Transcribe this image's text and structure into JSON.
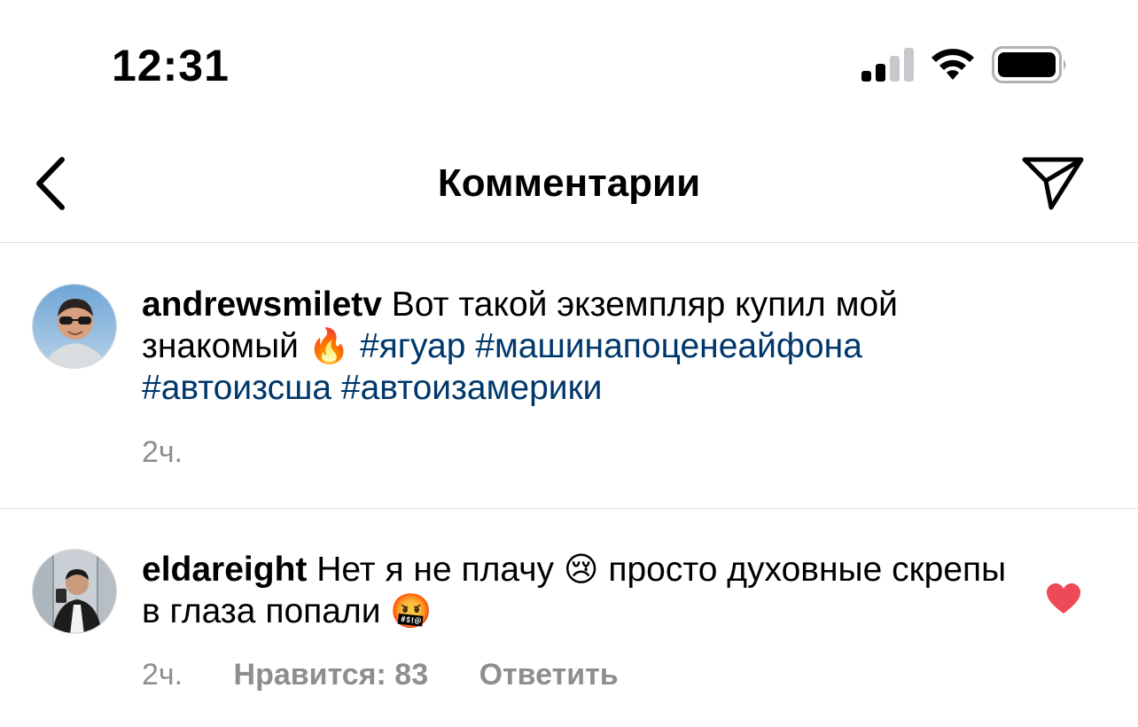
{
  "status_bar": {
    "time": "12:31",
    "signal_icon": "cellular-signal-icon",
    "wifi_icon": "wifi-icon",
    "battery_icon": "battery-icon"
  },
  "header": {
    "title": "Комментарии",
    "back_icon": "chevron-left-icon",
    "send_icon": "paper-plane-icon"
  },
  "colors": {
    "hashtag": "#00376b",
    "meta_text": "#8e8e8e",
    "like_heart": "#ed4956",
    "divider": "#dbdbdb"
  },
  "comments": [
    {
      "username": "andrewsmiletv",
      "text_part1": "Вот такой экземпляр купил мой знакомый",
      "emoji_1": "🔥",
      "hashtags": [
        "#ягуар",
        "#машинапоценеайфона",
        "#автоизсша",
        "#автоизамерики"
      ],
      "time": "2ч."
    },
    {
      "username": "eldareight",
      "text_part1": "Нет я не плачу",
      "emoji_1": "😢",
      "text_part2": "просто духовные скрепы в глаза попали",
      "emoji_2": "🤬",
      "time": "2ч.",
      "likes": "Нравится: 83",
      "reply": "Ответить",
      "liked_icon": "heart-filled-icon"
    }
  ]
}
